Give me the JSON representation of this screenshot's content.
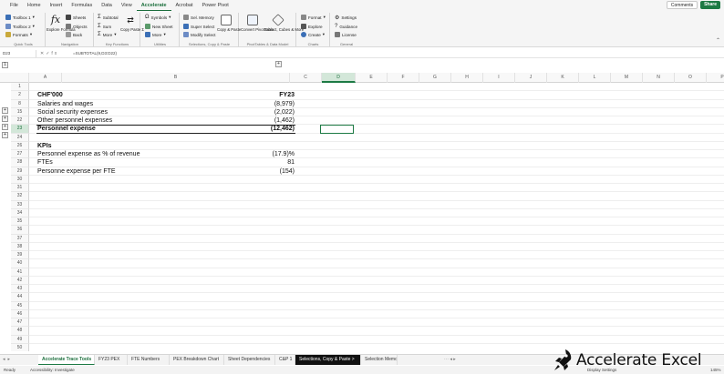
{
  "menu": {
    "items": [
      "File",
      "Home",
      "Insert",
      "Formulas",
      "Data",
      "View",
      "Accelerate",
      "Acrobat",
      "Power Pivot"
    ],
    "active": "Accelerate",
    "comments_label": "Comments",
    "share_label": "Share"
  },
  "ribbon": {
    "quick_tools": {
      "label": "Quick Tools",
      "toolbox1": "Toolbox 1",
      "toolbox2": "Toolbox 2",
      "formats": "Formats"
    },
    "navigation": {
      "label": "Navigation",
      "explore_formula": "Explore Formula",
      "sheets": "Sheets",
      "objects": "Objects",
      "back": "Back"
    },
    "key_functions": {
      "label": "Key Functions",
      "subtotal": "Subtotal",
      "sum": "Sum",
      "more": "More",
      "copy_paste": "Copy Paste Σ"
    },
    "utilities": {
      "label": "Utilities",
      "symbols": "Symbols",
      "new_sheet": "New Sheet",
      "more": "More"
    },
    "selections": {
      "label": "Selections, Copy & Paste",
      "sel_memory": "Sel. Memory",
      "super_select": "Super Select",
      "modify_select": "Modify Select",
      "copy_paste": "Copy & Paste"
    },
    "pivottables": {
      "label": "PivotTables & Data Model",
      "convert": "Convert PivotTable",
      "extract": "Extract, Cubes & More"
    },
    "charts": {
      "label": "Charts",
      "format": "Format",
      "explore": "Explore",
      "create": "Create"
    },
    "general": {
      "label": "General",
      "settings": "Settings",
      "guidance": "Guidance",
      "license": "License"
    }
  },
  "formula_bar": {
    "name_box": "D23",
    "formula": "=SUBTOTAL(9,D3:D22)"
  },
  "columns": [
    "A",
    "B",
    "C",
    "D",
    "E",
    "F",
    "G",
    "H",
    "I",
    "J",
    "K",
    "L",
    "M",
    "N",
    "O",
    "P",
    "Q"
  ],
  "selected_column": "D",
  "rows": [
    {
      "num": "1",
      "b": "",
      "d": "",
      "bold": false,
      "topline": false
    },
    {
      "num": "2",
      "b": "CHF'000",
      "d": "FY23",
      "bold": true,
      "topline": false
    },
    {
      "num": "8",
      "b": "Salaries and wages",
      "d": "(8,979)",
      "bold": false,
      "topline": false
    },
    {
      "num": "15",
      "b": "Social security expenses",
      "d": "(2,022)",
      "bold": false,
      "topline": false
    },
    {
      "num": "22",
      "b": "Other personnel expenses",
      "d": "(1,462)",
      "bold": false,
      "topline": false
    },
    {
      "num": "23",
      "b": "Personnel expense",
      "d": "(12,462)",
      "bold": true,
      "topline": true,
      "selected": true
    },
    {
      "num": "24",
      "b": "",
      "d": "",
      "bold": false,
      "topline": false
    },
    {
      "num": "26",
      "b": "KPIs",
      "d": "",
      "bold": true,
      "topline": false
    },
    {
      "num": "27",
      "b": "Personnel expense as % of revenue",
      "d": "(17.9)%",
      "bold": false,
      "topline": false
    },
    {
      "num": "28",
      "b": "FTEs",
      "d": "81",
      "bold": false,
      "topline": false
    },
    {
      "num": "29",
      "b": "Personne expense per FTE",
      "d": "(154)",
      "bold": false,
      "topline": false
    },
    {
      "num": "30"
    },
    {
      "num": "31"
    },
    {
      "num": "32"
    },
    {
      "num": "33"
    },
    {
      "num": "34"
    },
    {
      "num": "35"
    },
    {
      "num": "36"
    },
    {
      "num": "37"
    },
    {
      "num": "38"
    },
    {
      "num": "39"
    },
    {
      "num": "40"
    },
    {
      "num": "41"
    },
    {
      "num": "42"
    },
    {
      "num": "43"
    },
    {
      "num": "44"
    },
    {
      "num": "45"
    },
    {
      "num": "46"
    },
    {
      "num": "47"
    },
    {
      "num": "48"
    },
    {
      "num": "49"
    },
    {
      "num": "50"
    },
    {
      "num": "51"
    }
  ],
  "tabs": [
    {
      "label": "Accelerate Trace Tools",
      "active": true,
      "dark": false
    },
    {
      "label": "FY23 PEX",
      "active": false,
      "dark": false
    },
    {
      "label": "FTE Numbers",
      "active": false,
      "dark": false
    },
    {
      "label": "PEX Breakdown Chart",
      "active": false,
      "dark": false
    },
    {
      "label": "Sheet Dependencies",
      "active": false,
      "dark": false
    },
    {
      "label": "C&P 1",
      "active": false,
      "dark": false
    },
    {
      "label": "Selections, Copy & Paste >",
      "active": false,
      "dark": true
    },
    {
      "label": "Selection Memo",
      "active": false,
      "dark": false
    }
  ],
  "status": {
    "ready": "Ready",
    "accessibility": "Accessibility: Investigate",
    "display_settings": "Display Settings",
    "zoom": "145%"
  },
  "logo_text": "Accelerate Excel",
  "colors": {
    "accent": "#1d7a44",
    "selected_header": "#d3e7d9"
  }
}
